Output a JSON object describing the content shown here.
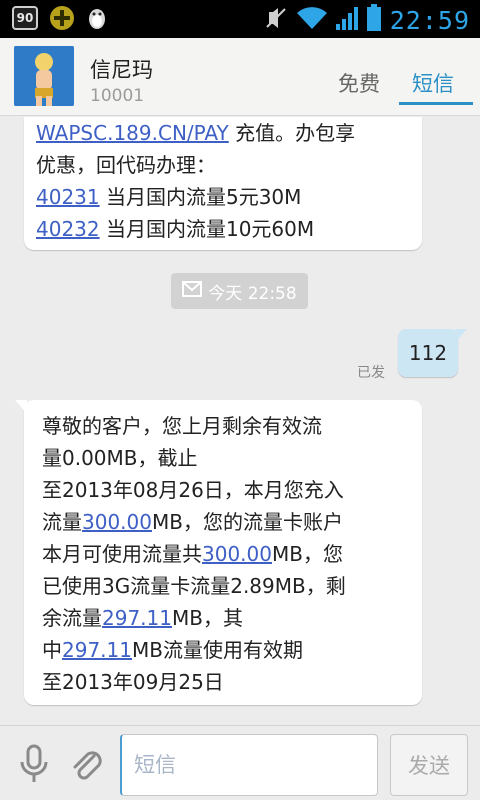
{
  "status_bar": {
    "badge_text": "90",
    "time": "22:59",
    "icons": [
      "app-badge-icon",
      "app-plus-icon",
      "penguin-icon",
      "mute-icon",
      "wifi-icon",
      "signal-icon",
      "battery-icon"
    ]
  },
  "header": {
    "contact_name": "信尼玛",
    "contact_number": "10001",
    "tabs": [
      {
        "label": "免费",
        "active": false
      },
      {
        "label": "短信",
        "active": true
      }
    ]
  },
  "messages": {
    "first": {
      "lines": [
        {
          "link": "WAPSC.189.CN/PAY",
          "text": " 充值。办包享"
        },
        {
          "text": "优惠，回代码办理："
        },
        {
          "link": "40231",
          "text": " 当月国内流量5元30M"
        },
        {
          "link": "40232",
          "text": " 当月国内流量10元60M"
        }
      ]
    },
    "date_divider": "今天 22:58",
    "outgoing": {
      "text": "112",
      "status": "已发"
    },
    "second": {
      "line1": "尊敬的客户，您上月剩余有效流",
      "line2": "量0.00MB，截止",
      "line3": "至2013年08月26日，本月您充入",
      "line4_pre": "流量",
      "line4_link": "300.00",
      "line4_post": "MB，您的流量卡账户",
      "line5_pre": "本月可使用流量共",
      "line5_link": "300.00",
      "line5_post": "MB，您",
      "line6": "已使用3G流量卡流量2.89MB，剩",
      "line7_pre": "余流量",
      "line7_link": "297.11",
      "line7_post": "MB，其",
      "line8_pre": "中",
      "line8_link": "297.11",
      "line8_post": "MB流量使用有效期",
      "line9": "至2013年09月25日"
    }
  },
  "input_bar": {
    "placeholder": "短信",
    "value": "",
    "send_label": "发送"
  },
  "colors": {
    "accent": "#2a90c6",
    "link": "#3e5fc5",
    "outgoing_bubble": "#cde6f4",
    "status_time": "#2ea5e6"
  }
}
